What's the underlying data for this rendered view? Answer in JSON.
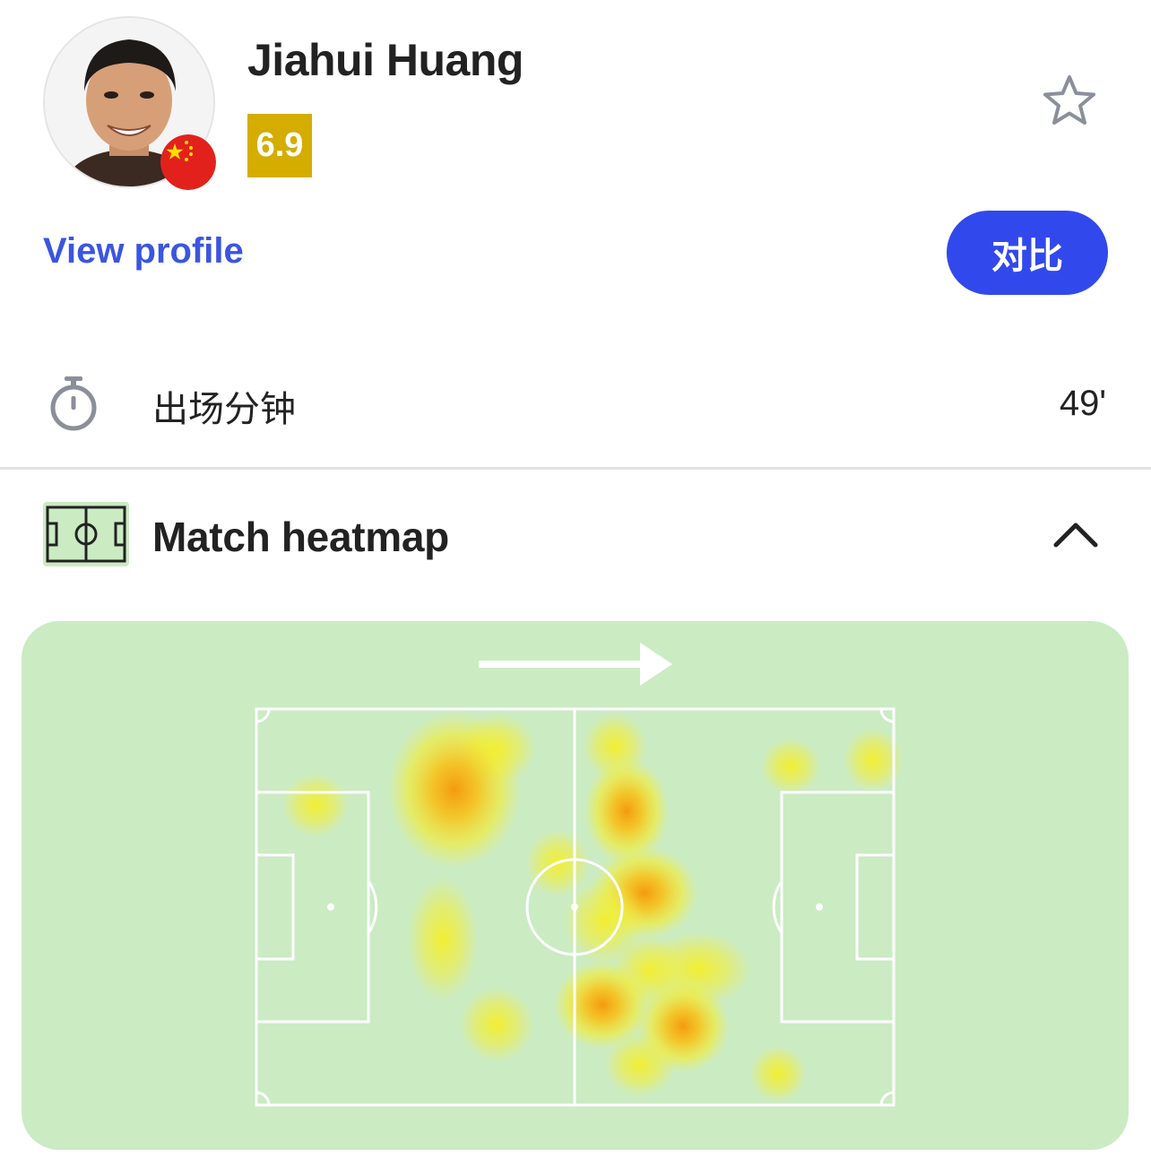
{
  "player": {
    "name": "Jiahui Huang",
    "rating": "6.9",
    "rating_color": "#d4ad00",
    "nationality_flag": "china-flag"
  },
  "actions": {
    "view_profile_label": "View profile",
    "compare_label": "对比",
    "favorite_icon": "star-outline-icon"
  },
  "stats": [
    {
      "icon": "stopwatch-icon",
      "label": "出场分钟",
      "value": "49'"
    }
  ],
  "heatmap": {
    "title": "Match heatmap",
    "section_icon": "pitch-icon",
    "toggle_icon": "chevron-up-icon",
    "attack_direction": "left-to-right",
    "background_color": "#cbebc3"
  },
  "colors": {
    "accent_blue": "#3149ec",
    "link_blue": "#3b55e0",
    "pitch_green": "#cbebc3"
  }
}
